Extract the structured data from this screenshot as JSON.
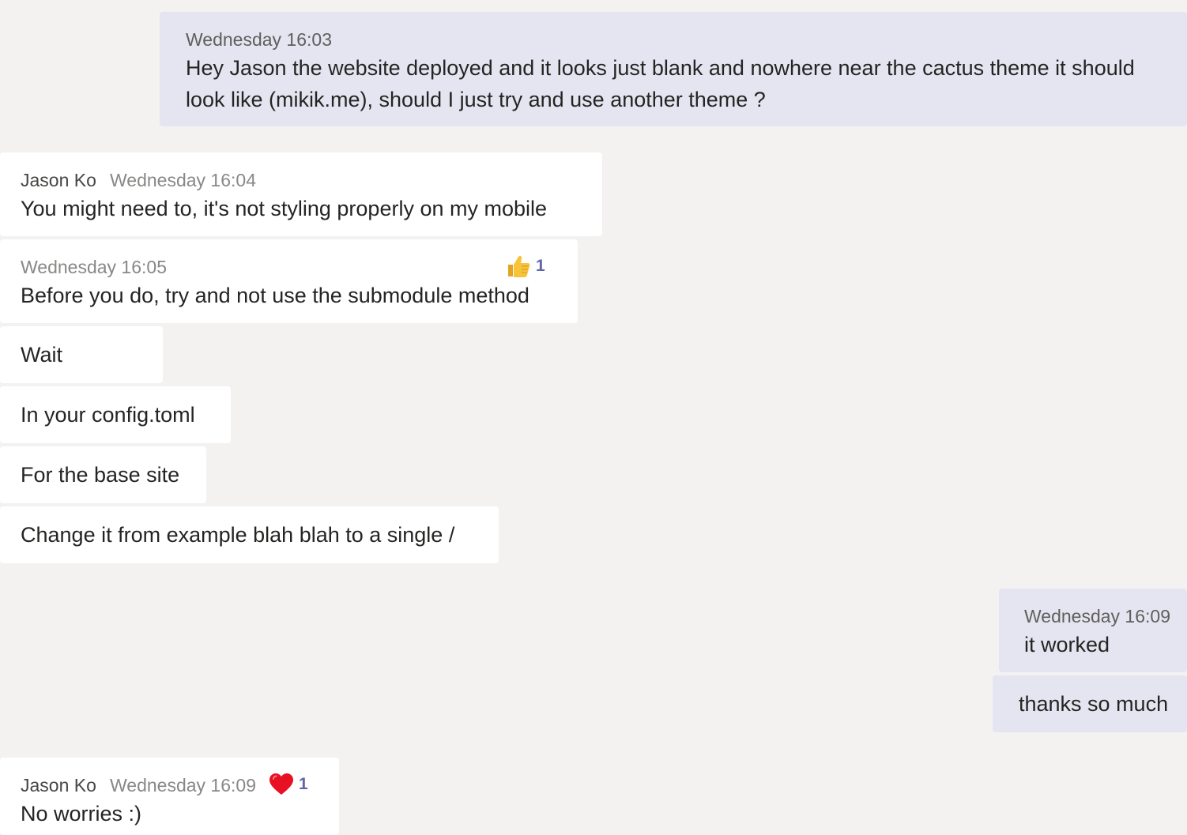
{
  "messages": [
    {
      "direction": "outgoing",
      "timestamp": "Wednesday 16:03",
      "lines": [
        "Hey Jason the website deployed and it looks just blank and nowhere near the cactus theme it should",
        "look like (mikik.me), should I just try and use another theme ?"
      ]
    },
    {
      "direction": "incoming",
      "author": "Jason Ko",
      "timestamp": "Wednesday 16:04",
      "text": "You might need to, it's not styling properly on my mobile"
    },
    {
      "direction": "incoming",
      "timestamp": "Wednesday 16:05",
      "text": "Before you do, try and not use the submodule method",
      "reaction": {
        "icon": "thumbs-up-icon",
        "count": "1"
      }
    },
    {
      "direction": "incoming",
      "text": "Wait"
    },
    {
      "direction": "incoming",
      "text": "In your config.toml"
    },
    {
      "direction": "incoming",
      "text": "For the base site"
    },
    {
      "direction": "incoming",
      "text": "Change it from example blah blah to a single /"
    },
    {
      "direction": "outgoing",
      "timestamp": "Wednesday 16:09",
      "text": "it worked"
    },
    {
      "direction": "outgoing",
      "text": "thanks so much"
    },
    {
      "direction": "incoming",
      "author": "Jason Ko",
      "timestamp": "Wednesday 16:09",
      "text": "No worries :)",
      "reaction": {
        "icon": "heart-icon",
        "count": "1"
      }
    }
  ],
  "colors": {
    "background": "#f3f2f1",
    "incoming_bubble": "#ffffff",
    "outgoing_bubble": "#e5e5f1",
    "reaction_count": "#6264a7",
    "heart": "#e81123",
    "thumbs_up": "#f7c33a"
  }
}
